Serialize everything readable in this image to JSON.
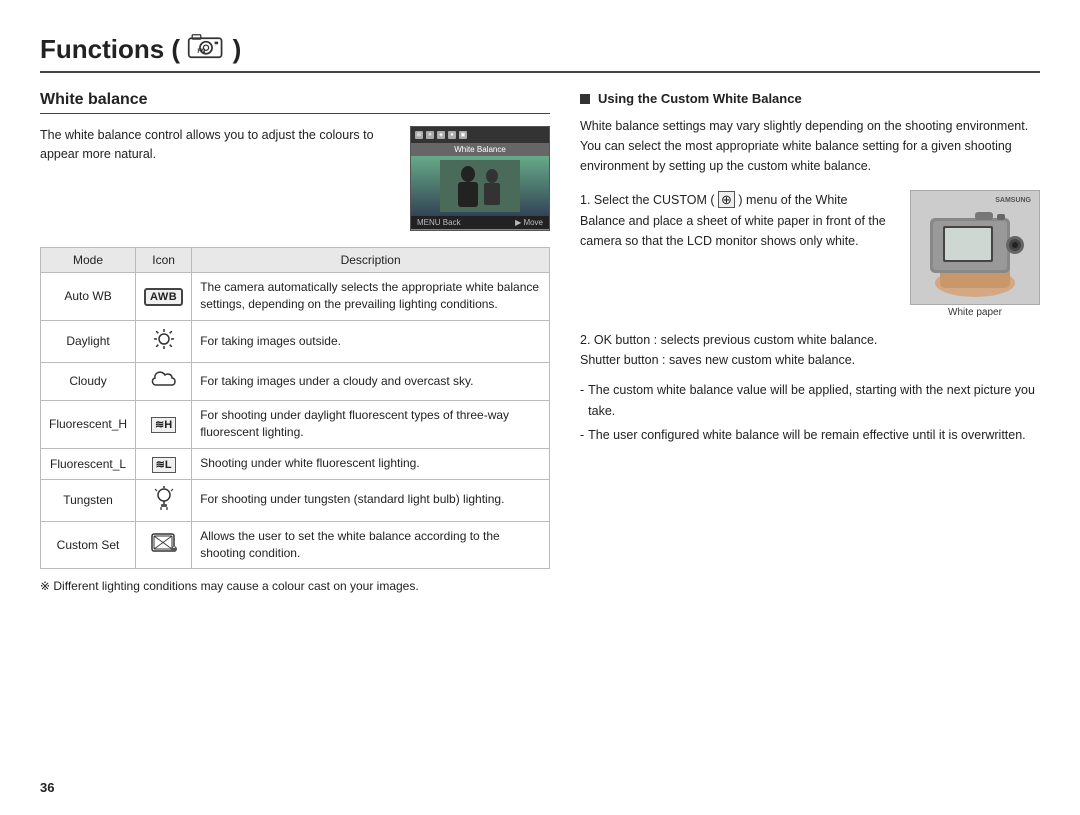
{
  "header": {
    "title": "Functions (",
    "title_suffix": " )",
    "camera_icon": "📷"
  },
  "section": {
    "title": "White balance"
  },
  "intro": {
    "text": "The white balance control allows you to adjust the colours to appear more natural."
  },
  "table": {
    "headers": [
      "Mode",
      "Icon",
      "Description"
    ],
    "rows": [
      {
        "mode": "Auto WB",
        "icon_type": "awb",
        "icon_label": "AWB",
        "description": "The camera automatically selects the appropriate white balance settings, depending on the prevailing lighting conditions."
      },
      {
        "mode": "Daylight",
        "icon_type": "sun",
        "icon_label": "☀",
        "description": "For taking images outside."
      },
      {
        "mode": "Cloudy",
        "icon_type": "cloud",
        "icon_label": "☁",
        "description": "For taking images under a cloudy and overcast sky."
      },
      {
        "mode": "Fluorescent_H",
        "icon_type": "fluor_h",
        "icon_label": "≋H",
        "description": "For shooting under daylight fluorescent types of three-way fluorescent lighting."
      },
      {
        "mode": "Fluorescent_L",
        "icon_type": "fluor_l",
        "icon_label": "≋L",
        "description": "Shooting under white fluorescent lighting."
      },
      {
        "mode": "Tungsten",
        "icon_type": "tungsten",
        "icon_label": "💡",
        "description": "For shooting under tungsten (standard light bulb) lighting."
      },
      {
        "mode": "Custom Set",
        "icon_type": "custom",
        "icon_label": "🖼",
        "description": "Allows the user to set the white balance according to the shooting condition."
      }
    ]
  },
  "note": {
    "text": "※ Different lighting conditions may cause a colour cast on your images."
  },
  "right_section": {
    "title": "Using the Custom White Balance",
    "intro": "White balance settings may vary slightly depending on the shooting environment. You can select the most appropriate white balance setting for a given shooting environment by setting up the custom white balance.",
    "step1_label": "1. Select the CUSTOM (",
    "step1_icon": "🎨",
    "step1_cont": ") menu of the White Balance and place a sheet of white paper in front of the camera so that the LCD monitor shows only white.",
    "camera_label": "White paper",
    "step2_label": "2. OK button",
    "step2_colon": " : selects previous custom white balance.",
    "step2b_label": "Shutter button",
    "step2b_colon": " : saves new custom white balance.",
    "bullet1": "The custom white balance value will be applied, starting with the next picture you take.",
    "bullet2": "The user configured white balance will be remain effective until it is overwritten."
  },
  "page_number": "36"
}
